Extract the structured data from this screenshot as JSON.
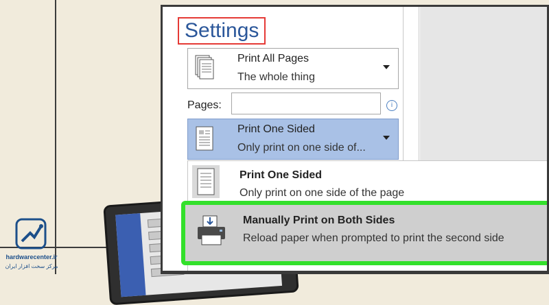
{
  "settings": {
    "title": "Settings",
    "print_pages": {
      "title": "Print All Pages",
      "subtitle": "The whole thing"
    },
    "pages_field": {
      "label": "Pages:",
      "value": ""
    },
    "sided_dropdown": {
      "title": "Print One Sided",
      "subtitle": "Only print on one side of..."
    },
    "menu": {
      "options": [
        {
          "title": "Print One Sided",
          "description": "Only print on one side of the page"
        },
        {
          "title": "Manually Print on Both Sides",
          "description": "Reload paper when prompted to print the second side"
        }
      ]
    }
  },
  "logo": {
    "text": "hardwarecenter.ir",
    "subtext": "مرکز سخت افزار ایران"
  },
  "colors": {
    "accent": "#2b579a",
    "highlight_outline": "#33e02b",
    "title_outline": "#e53935",
    "selected_dropdown": "#a9c1e6"
  },
  "icons": {
    "pages": "document-stack-icon",
    "sided": "single-page-icon",
    "manual_duplex": "printer-icon",
    "info": "info-icon",
    "dropdown": "chevron-down-icon"
  }
}
